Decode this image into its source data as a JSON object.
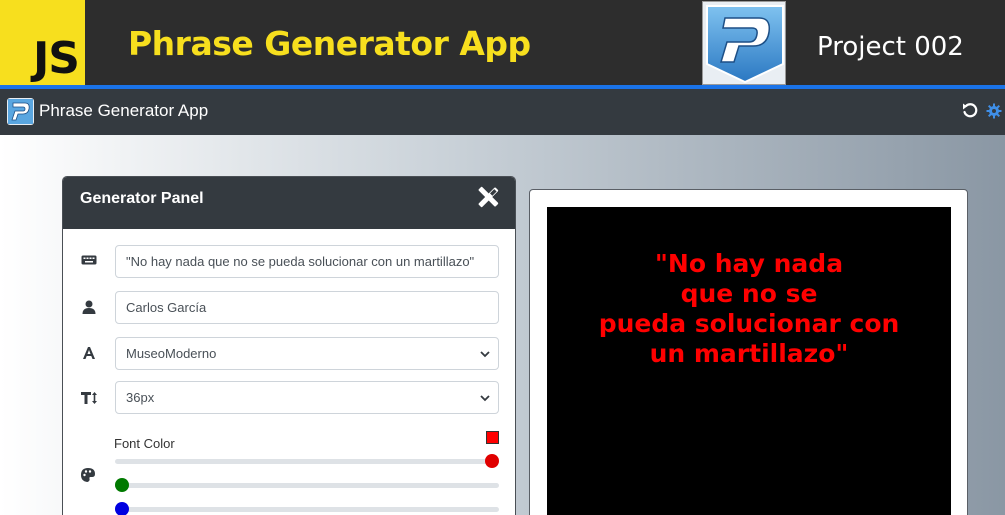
{
  "banner": {
    "logo_text": "JS",
    "title": "Phrase Generator App",
    "right_text": "Project 002"
  },
  "app": {
    "title": "Phrase Generator App",
    "icons": [
      "app-logo-icon",
      "undo-icon",
      "gear-icon"
    ]
  },
  "panel": {
    "title": "Generator Panel",
    "header_icon": "tools-icon",
    "phrase_value": "\"No hay nada que no se pueda solucionar con un martillazo\"",
    "author_value": "Carlos García",
    "font_value": "MuseoModerno",
    "size_value": "36px",
    "color_label": "Font Color",
    "color": "#ff0000",
    "rgb": {
      "r": 255,
      "g": 0,
      "b": 0
    }
  },
  "preview": {
    "lines": "\"No hay nada\nque no se\npueda solucionar con\nun martillazo\"",
    "text_color": "#ff0000",
    "background": "#000000"
  },
  "colors": {
    "accent_blue": "#1a73e8",
    "js_yellow": "#f7df1e",
    "dark": "#343a40"
  }
}
